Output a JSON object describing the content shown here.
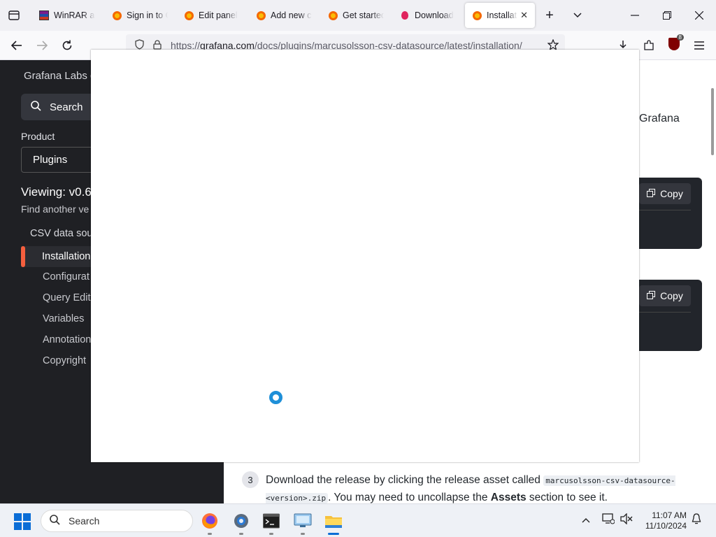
{
  "browser": {
    "tabs": [
      {
        "title": "WinRAR and",
        "favicon": "winrar-icon"
      },
      {
        "title": "Sign in to Grafana",
        "favicon": "grafana-icon"
      },
      {
        "title": "Edit panel",
        "favicon": "grafana-icon"
      },
      {
        "title": "Add new connection",
        "favicon": "grafana-icon"
      },
      {
        "title": "Get started",
        "favicon": "grafana-icon"
      },
      {
        "title": "Download",
        "favicon": "download-icon"
      },
      {
        "title": "Installation",
        "favicon": "grafana-icon",
        "active": true
      }
    ],
    "url_prefix": "https://",
    "url_domain": "grafana.com",
    "url_path": "/docs/plugins/marcusolsson-csv-datasource/latest/installation/",
    "ublock_count": "8"
  },
  "sidebar": {
    "org": "Grafana Labs d",
    "search_label": "Search",
    "product_label": "Product",
    "product_value": "Plugins",
    "viewing": "Viewing: v0.6",
    "find_another": "Find another ve",
    "section": "CSV data sou",
    "items": [
      "Installation",
      "Configurat",
      "Query Edit",
      "Variables",
      "Annotation",
      "Copyright"
    ]
  },
  "content": {
    "grafana_fragment": "Grafana",
    "copy_label": "Copy",
    "step_number": "3",
    "step_text_1": "Download the release by clicking the release asset called ",
    "step_code": "marcusolsson-csv-datasource-<version>.zip",
    "step_text_2": ". You may need to uncollapse the ",
    "step_bold": "Assets",
    "step_text_3": " section to see it."
  },
  "taskbar": {
    "search_label": "Search",
    "time": "11:07 AM",
    "date": "11/10/2024",
    "apps": [
      "firefox-icon",
      "settings-icon",
      "terminal-icon",
      "remote-desktop-icon",
      "file-explorer-icon"
    ]
  },
  "colors": {
    "sidebar_bg": "#1f2024",
    "accent": "#f55f3e",
    "spinner": "#1e8fd8"
  }
}
